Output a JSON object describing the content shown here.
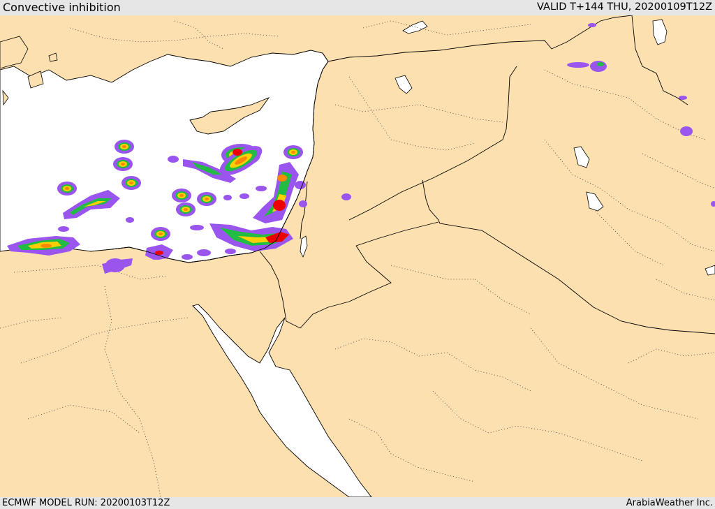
{
  "header": {
    "title": "Convective inhibition",
    "valid_time": "VALID T+144 THU, 20200109T12Z"
  },
  "footer": {
    "model_run": "ECMWF MODEL RUN: 20200103T12Z",
    "credit": "ArabiaWeather Inc."
  },
  "map": {
    "land_color": "#fde0b0",
    "water_color": "#ffffff",
    "border_color": "#000000"
  },
  "cin_colors": {
    "outer": "#9955ee",
    "mid": "#22bb44",
    "inner": "#ffd000",
    "high": "#ff8800",
    "max": "#ee0000"
  }
}
